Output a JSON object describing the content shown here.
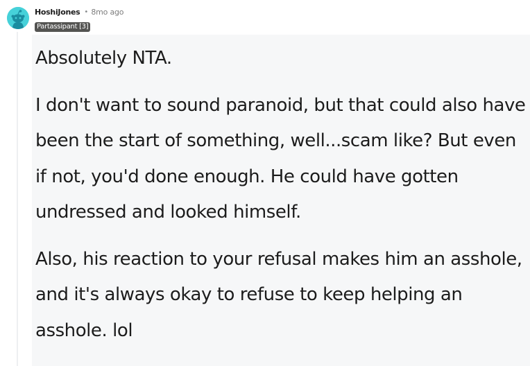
{
  "comment": {
    "author": "HoshiJones",
    "separator": "•",
    "timestamp": "8mo ago",
    "flair": "Partassipant [3]",
    "paragraphs": [
      "Absolutely NTA.",
      "I don't want to sound paranoid, but that could also have been the start of something, well...scam like? But even if not, you'd done enough. He could have gotten undressed and looked himself.",
      "Also, his reaction to your refusal makes him an asshole, and it's always okay to refuse to keep helping an asshole. lol"
    ]
  },
  "colors": {
    "avatar_bg": "#46d1d9",
    "flair_bg": "#545452",
    "content_bg": "#f6f7f8",
    "text": "#1c1c1c",
    "meta_text": "#7c7c7c"
  },
  "icons": {
    "avatar": "reddit-snoo-avatar-icon"
  }
}
